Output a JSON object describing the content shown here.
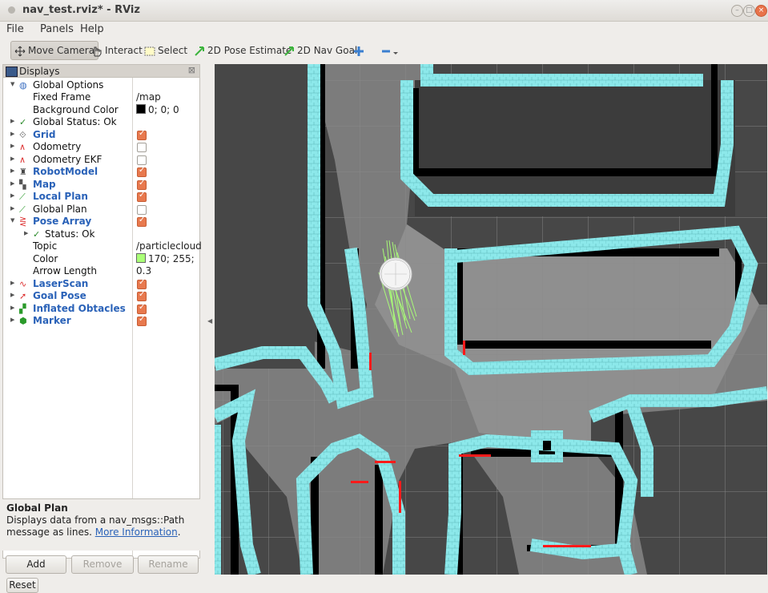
{
  "window": {
    "title": "nav_test.rviz* - RViz"
  },
  "menu": [
    "File",
    "Panels",
    "Help"
  ],
  "toolbar": {
    "move_camera": "Move Camera",
    "interact": "Interact",
    "select": "Select",
    "pose_estimate": "2D Pose Estimate",
    "nav_goal": "2D Nav Goal"
  },
  "displays_panel": {
    "title": "Displays",
    "rows": [
      {
        "label": "Global Options",
        "value": ""
      },
      {
        "label": "Fixed Frame",
        "value": "/map"
      },
      {
        "label": "Background Color",
        "value": "0; 0; 0"
      },
      {
        "label": "Global Status: Ok",
        "value": ""
      },
      {
        "label": "Grid",
        "checked": true
      },
      {
        "label": "Odometry",
        "checked": false
      },
      {
        "label": "Odometry EKF",
        "checked": false
      },
      {
        "label": "RobotModel",
        "checked": true
      },
      {
        "label": "Map",
        "checked": true
      },
      {
        "label": "Local Plan",
        "checked": true
      },
      {
        "label": "Global Plan",
        "checked": false
      },
      {
        "label": "Pose Array",
        "checked": true
      },
      {
        "label": "Status: Ok",
        "value": ""
      },
      {
        "label": "Topic",
        "value": "/particlecloud"
      },
      {
        "label": "Color",
        "value": "170; 255;"
      },
      {
        "label": "Arrow Length",
        "value": "0.3"
      },
      {
        "label": "LaserScan",
        "checked": true
      },
      {
        "label": "Goal Pose",
        "checked": true
      },
      {
        "label": "Inflated Obtacles",
        "checked": true
      },
      {
        "label": "Marker",
        "checked": true
      }
    ]
  },
  "description": {
    "title": "Global Plan",
    "text": "Displays data from a nav_msgs::Path message as lines.",
    "link": "More Information"
  },
  "buttons": {
    "add": "Add",
    "remove": "Remove",
    "rename": "Rename",
    "reset": "Reset"
  },
  "colors": {
    "map_inflation": "#8ce8ea",
    "particles": "#aaff77",
    "laser": "#ff0000",
    "checkbox_on": "#e8794e"
  }
}
